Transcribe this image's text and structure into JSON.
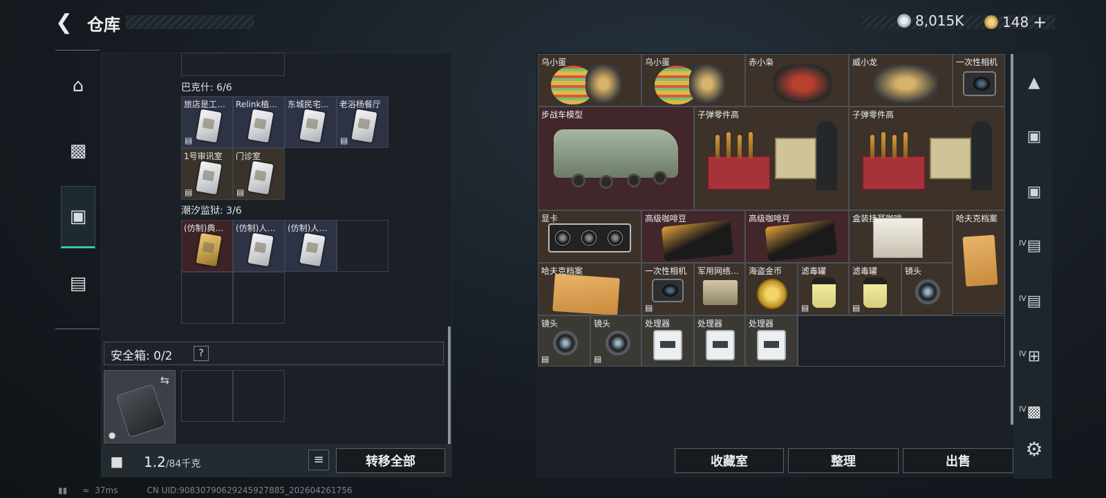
{
  "header": {
    "title": "仓库",
    "back_icon": "chevron-left-icon"
  },
  "currency": {
    "money": "8,015K",
    "coupons": "148",
    "add": "+",
    "money_color": "#c8ccd0",
    "coupon_color": "#d8b25a"
  },
  "left_nav": [
    {
      "icon": "gun-icon"
    },
    {
      "icon": "armor-vest-icon"
    },
    {
      "icon": "backpack-icon",
      "active": true
    },
    {
      "icon": "toolbox-icon"
    }
  ],
  "groups": {
    "bakesh": {
      "label": "巴克什: 6/6",
      "items": [
        "旅店是工…",
        "Relink植…",
        "东城民宅…",
        "老浴杨餐厅",
        "1号审讯室",
        "门诊室"
      ]
    },
    "prison": {
      "label": "潮汐监狱: 3/6",
      "items": [
        "(仿制)典…",
        "(仿制)人…",
        "(仿制)人…"
      ]
    }
  },
  "safe": {
    "title": "安全箱:",
    "count": "0/2",
    "help": "?"
  },
  "weight": {
    "value": "1.2",
    "unit": "/84千克"
  },
  "buttons": {
    "transfer_all": "转移全部",
    "collection": "收藏室",
    "sort": "整理",
    "sell": "出售"
  },
  "stash": {
    "r1": [
      "乌小蛋",
      "乌小蛋",
      "赤小枭",
      "威小龙",
      "一次性相机"
    ],
    "r2": [
      "步战车模型",
      "子弹零件高",
      "子弹零件高"
    ],
    "r3": [
      "显卡",
      "高级咖啡豆",
      "高级咖啡豆",
      "盒装挂耳咖啡",
      "哈夫克档案"
    ],
    "r4": [
      "哈夫克档案",
      "一次性相机",
      "军用网络…",
      "海盗金币",
      "滤毒罐",
      "滤毒罐",
      "镜头"
    ],
    "r5": [
      "镜头",
      "镜头",
      "处理器",
      "处理器",
      "处理器"
    ]
  },
  "right_nav": [
    {
      "icon": "storage-icon",
      "level": ""
    },
    {
      "icon": "case-a-icon",
      "level": ""
    },
    {
      "icon": "case-b-icon",
      "level": ""
    },
    {
      "icon": "case-c-icon",
      "level": "IV"
    },
    {
      "icon": "case-d-icon",
      "level": "IV"
    },
    {
      "icon": "case-add-icon",
      "level": "IV"
    },
    {
      "icon": "case-active-icon",
      "level": "IV"
    },
    {
      "icon": "settings-gear-icon",
      "level": ""
    }
  ],
  "status": {
    "ping": "37ms",
    "uid": "CN UID:9083079062924592788​5_202604261756"
  }
}
